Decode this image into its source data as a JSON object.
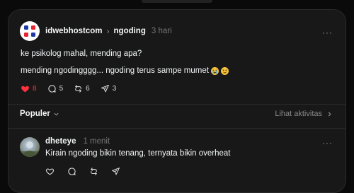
{
  "post": {
    "username": "idwebhostcom",
    "community": "ngoding",
    "time": "3 hari",
    "line1": "ke psikolog mahal, mending apa?",
    "line2": "mending ngodingggg... ngoding terus sampe mumet",
    "likes": "8",
    "comments": "5",
    "reposts": "6",
    "shares": "3",
    "more_label": "···",
    "like_color": "#ff3040"
  },
  "sort": {
    "label": "Populer",
    "activity_label": "Lihat aktivitas"
  },
  "reply": {
    "username": "dheteye",
    "time": "1 menit",
    "text": "Kirain ngoding bikin tenang, ternyata bikin overheat",
    "more_label": "···"
  },
  "icons": [
    "heart-icon",
    "comment-icon",
    "repost-icon",
    "share-icon",
    "chevron-right-icon",
    "chevron-down-icon",
    "more-icon"
  ]
}
